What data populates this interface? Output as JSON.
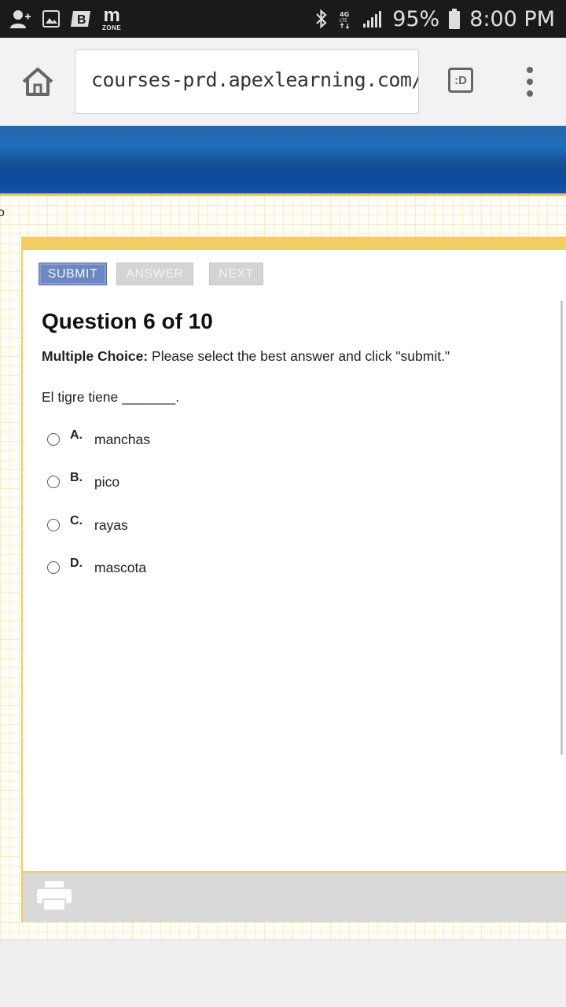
{
  "status_bar": {
    "left_icons": [
      "add-contact-icon",
      "image-icon",
      "bold-b-icon",
      "mzone-icon"
    ],
    "mzone": {
      "m": "m",
      "zone": "ZONE"
    },
    "right_icons": [
      "bluetooth-icon",
      "4g-lte-icon",
      "signal-icon",
      "battery-icon"
    ],
    "battery": "95%",
    "time": "8:00 PM"
  },
  "browser": {
    "url": "courses-prd.apexlearning.com/",
    "tabs_label": ":D"
  },
  "page": {
    "edge_text": "o",
    "buttons": {
      "submit": "SUBMIT",
      "answer": "ANSWER",
      "next": "NEXT"
    },
    "question_title": "Question 6 of 10",
    "instructions": {
      "label": "Multiple Choice:",
      "text": "Please select the best answer and click \"submit.\""
    },
    "prompt": "El tigre tiene _______.",
    "choices": [
      {
        "letter": "A.",
        "text": "manchas"
      },
      {
        "letter": "B.",
        "text": "pico"
      },
      {
        "letter": "C.",
        "text": "rayas"
      },
      {
        "letter": "D.",
        "text": "mascota"
      }
    ]
  },
  "colors": {
    "accent_gold": "#f2cd61",
    "banner_blue": "#1a5aa6",
    "submit_blue": "#6d87c3"
  }
}
